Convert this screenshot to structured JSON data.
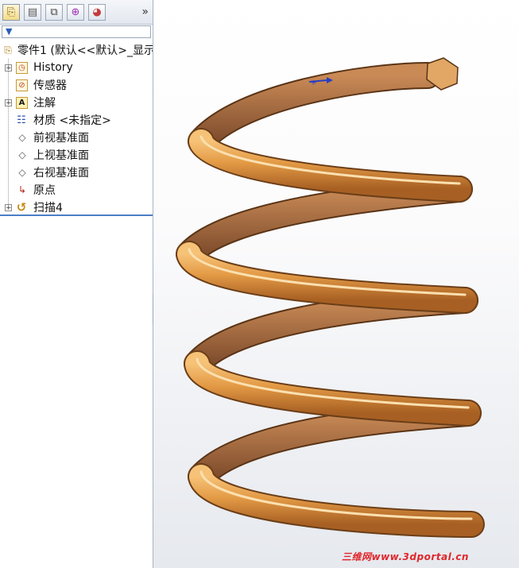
{
  "panel": {
    "more_label": "»",
    "tree": [
      {
        "label": "零件1 (默认<<默认>_显示",
        "icon": "part-icon"
      },
      {
        "label": "History",
        "icon": "history-icon"
      },
      {
        "label": "传感器",
        "icon": "sensor-icon"
      },
      {
        "label": "注解",
        "icon": "annotation-icon"
      },
      {
        "label": "材质 <未指定>",
        "icon": "material-icon"
      },
      {
        "label": "前视基准面",
        "icon": "plane-icon"
      },
      {
        "label": "上视基准面",
        "icon": "plane-icon"
      },
      {
        "label": "右视基准面",
        "icon": "plane-icon"
      },
      {
        "label": "原点",
        "icon": "origin-icon"
      },
      {
        "label": "扫描4",
        "icon": "sweep-icon"
      }
    ]
  },
  "viewport": {
    "model": "helical-spring",
    "spring_color": "#d9913b",
    "watermark": "三维网www.3dportal.cn"
  }
}
